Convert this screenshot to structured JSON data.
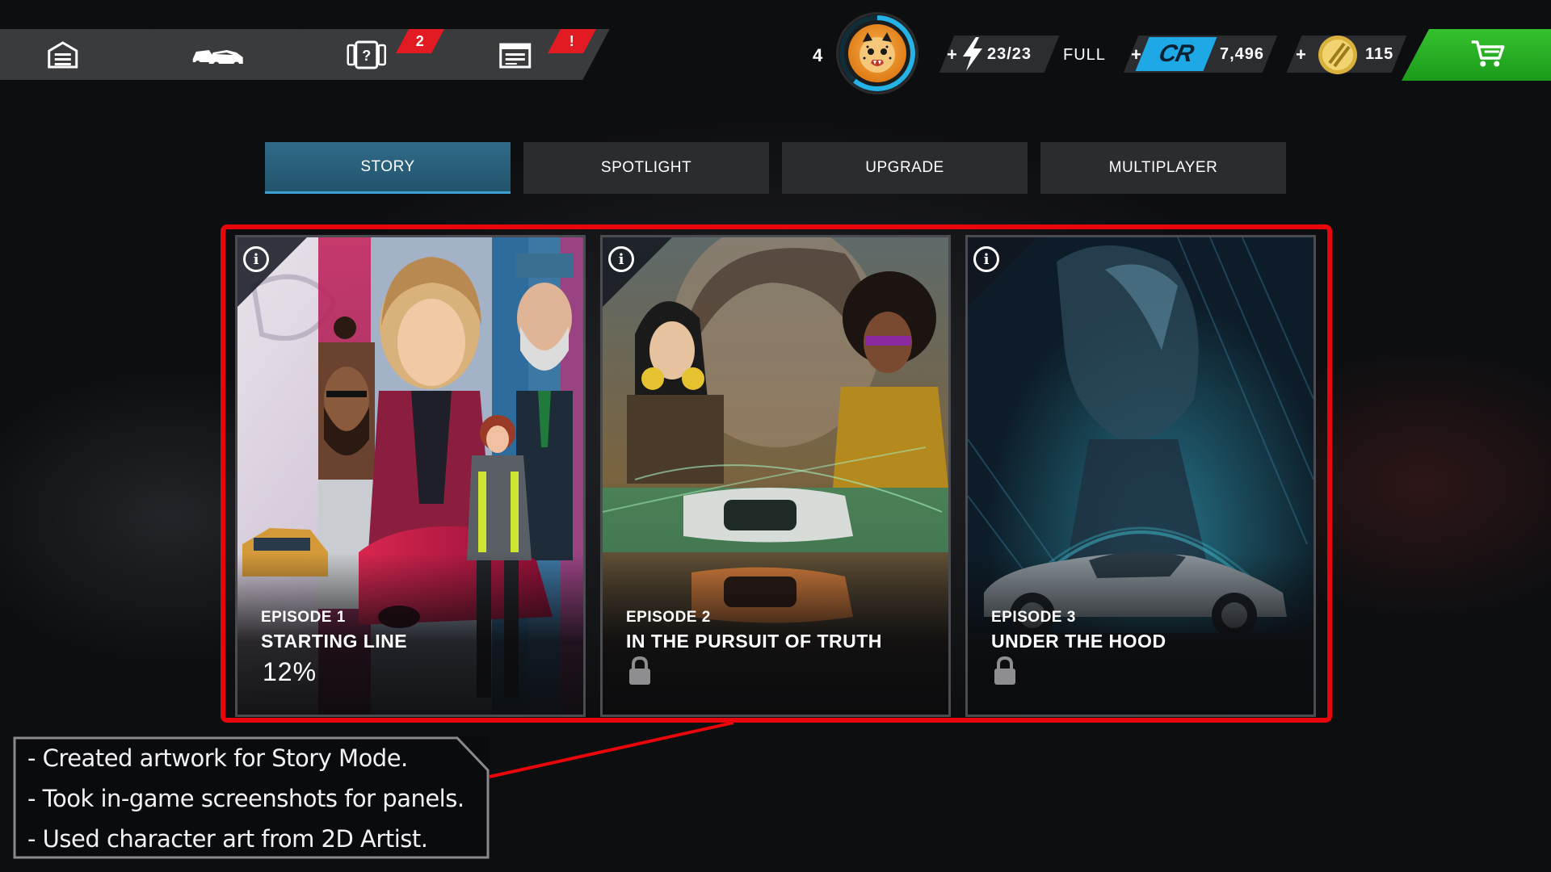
{
  "topbar": {
    "nav": [
      {
        "icon": "garage-icon"
      },
      {
        "icon": "cars-icon"
      },
      {
        "icon": "mystery-cards-icon",
        "badge": "2"
      },
      {
        "icon": "calendar-icon",
        "badge": "!"
      }
    ],
    "player_level": "4",
    "avatar_icon": "cheetah-avatar-icon",
    "fuel": {
      "plus": "+",
      "value": "23/23",
      "status": "FULL",
      "icon": "lightning-icon"
    },
    "cash": {
      "plus": "+",
      "icon": "cr-currency-icon",
      "label": "CR",
      "value": "7,496"
    },
    "gold": {
      "plus": "+",
      "icon": "gold-coin-icon",
      "value": "115"
    },
    "shop_icon": "cart-icon",
    "colors": {
      "accent_blue": "#1fa8e6",
      "shop_green": "#2eb52a",
      "badge_red": "#e21b23"
    }
  },
  "mode_tabs": [
    {
      "label": "STORY",
      "active": true
    },
    {
      "label": "SPOTLIGHT",
      "active": false
    },
    {
      "label": "UPGRADE",
      "active": false
    },
    {
      "label": "MULTIPLAYER",
      "active": false
    }
  ],
  "episodes": [
    {
      "number": "EPISODE 1",
      "title": "STARTING LINE",
      "progress": "12%",
      "locked": false
    },
    {
      "number": "EPISODE 2",
      "title": "IN THE PURSUIT OF TRUTH",
      "locked": true
    },
    {
      "number": "EPISODE 3",
      "title": "UNDER THE HOOD",
      "locked": true
    }
  ],
  "highlight_color": "#e8050b",
  "notes": [
    "- Created artwork for Story Mode.",
    "- Took in-game screenshots for panels.",
    "- Used character art from 2D Artist."
  ]
}
